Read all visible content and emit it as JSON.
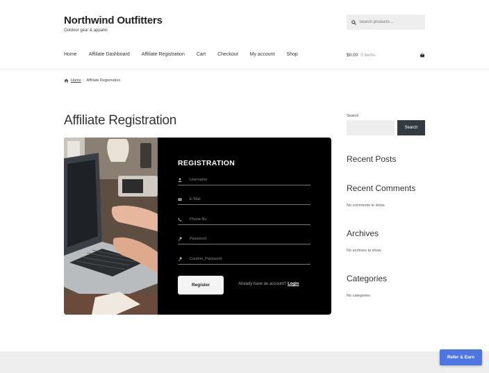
{
  "site": {
    "title": "Northwind Outfitters",
    "tagline": "Outdoor gear & apparel"
  },
  "header_search": {
    "placeholder": "Search products…"
  },
  "nav": {
    "items": [
      "Home",
      "Affiliate Dashboard",
      "Affiliate Registration",
      "Cart",
      "Checkout",
      "My account",
      "Shop"
    ]
  },
  "cart": {
    "amount": "$0.00",
    "items": "0 items"
  },
  "breadcrumb": {
    "home": "Home",
    "separator": "›",
    "current": "Affiliate Registration"
  },
  "page": {
    "title": "Affiliate Registration"
  },
  "registration": {
    "title": "REGISTRATION",
    "fields": [
      {
        "placeholder": "Username",
        "icon": "user-icon"
      },
      {
        "placeholder": "E-Mail",
        "icon": "envelope-icon"
      },
      {
        "placeholder": "Phone No.",
        "icon": "phone-icon"
      },
      {
        "placeholder": "Password",
        "icon": "key-icon"
      },
      {
        "placeholder": "Confirm_Password",
        "icon": "key-icon"
      }
    ],
    "register_label": "Register",
    "login_prompt": "Already have an account?",
    "login_label": "Login"
  },
  "sidebar": {
    "search_label": "Search",
    "search_button": "Search",
    "recent_posts": "Recent Posts",
    "recent_comments": "Recent Comments",
    "no_comments": "No comments to show.",
    "archives": "Archives",
    "no_archives": "No archives to show.",
    "categories": "Categories",
    "no_categories": "No categories"
  },
  "refer_button": "Refer & Earn",
  "colors": {
    "accent": "#4d76e3",
    "card_background": "#000000",
    "search_button": "#333a40"
  }
}
